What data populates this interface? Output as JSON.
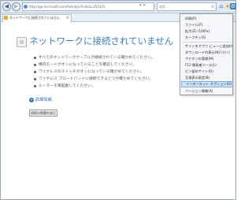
{
  "browser": {
    "url": "http://go.microsoft.com/fwlink/p/?linkid=255141",
    "search_placeholder": "検索...",
    "tab_title": "ネットワークに接続されていません"
  },
  "error_page": {
    "title": "ネットワークに接続されていません",
    "bullets": [
      "すべてのネットワークケーブルが接続されている確かめてください。",
      "機内モードがオンになっていることを確認してください。",
      "ワイヤレスのスイッチがオンになっている確かめてください。",
      "ワイヤレス ブロードバンドに接続できるどうか確かめてください。",
      "ルーターを再起動してください。"
    ],
    "details_label": "詳細情報",
    "fix_button_label": "接続の問題を修正"
  },
  "tools_menu": {
    "items": [
      {
        "label": "印刷(P)",
        "shortcut": ""
      },
      {
        "label": "ファイル(F)",
        "shortcut": ""
      },
      {
        "label": "拡大(Z) (100%)",
        "shortcut": ""
      },
      {
        "label": "セーフティ(S)",
        "shortcut": ""
      },
      {
        "label": "サイトをアプリ ビューに追加(I)",
        "shortcut": ""
      },
      {
        "label": "ダウンロードの表示(N)",
        "shortcut": "Ctrl+J"
      },
      {
        "label": "アドオンの管理(M)",
        "shortcut": ""
      },
      {
        "label": "F12 開発者ツール(L)",
        "shortcut": ""
      },
      {
        "label": "ピン留めサイト(G)",
        "shortcut": ""
      },
      {
        "label": "互換表示設定(B)",
        "shortcut": ""
      },
      {
        "label": "インターネット オプション(O)",
        "shortcut": ""
      },
      {
        "label": "バージョン情報(A)",
        "shortcut": ""
      }
    ],
    "selected_index": 10
  },
  "icons": {
    "back": "back-arrow-icon",
    "forward": "forward-arrow-icon",
    "home": "home-icon",
    "favorites": "star-icon",
    "tools": "gear-icon"
  },
  "colors": {
    "title_blue": "#3b7fc4",
    "link_blue": "#2e6fb8",
    "menu_highlight": "#cde3fa"
  }
}
